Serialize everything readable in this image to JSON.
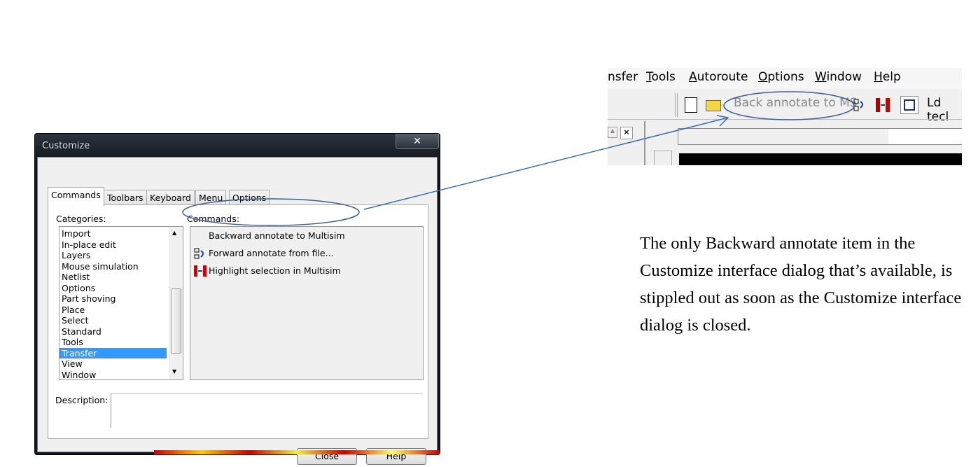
{
  "dialog": {
    "title": "Customize",
    "close_glyph": "✕",
    "tabs": [
      "Commands",
      "Toolbars",
      "Keyboard",
      "Menu",
      "Options"
    ],
    "categories_label": "Categories:",
    "categories": [
      "Import",
      "In-place edit",
      "Layers",
      "Mouse simulation",
      "Netlist",
      "Options",
      "Part shoving",
      "Place",
      "Select",
      "Standard",
      "Tools",
      "Transfer",
      "View",
      "Window"
    ],
    "selected_category": "Transfer",
    "commands_label": "Commands:",
    "commands": [
      "Backward annotate to Multisim",
      "Forward annotate from file...",
      "Highlight selection in Multisim"
    ],
    "description_label": "Description:",
    "close_button": "Close",
    "help_button": "Help"
  },
  "app_screenshot": {
    "menu": [
      {
        "label": "nsfer",
        "u": ""
      },
      {
        "label": "ools",
        "u": "T"
      },
      {
        "label": "utoroute",
        "u": "A"
      },
      {
        "label": "ptions",
        "u": "O"
      },
      {
        "label": "indow",
        "u": "W"
      },
      {
        "label": "elp",
        "u": "H"
      }
    ],
    "toolbar_button": "Back annotate to MS",
    "toolbar_trailing": "Ld tecl"
  },
  "caption": "The only Backward annotate item in the Customize interface dialog that’s available, is stippled out as soon as the Customize interface dialog is closed.",
  "colors": {
    "annotation": "#3d6fb0",
    "selection": "#3399ff"
  }
}
